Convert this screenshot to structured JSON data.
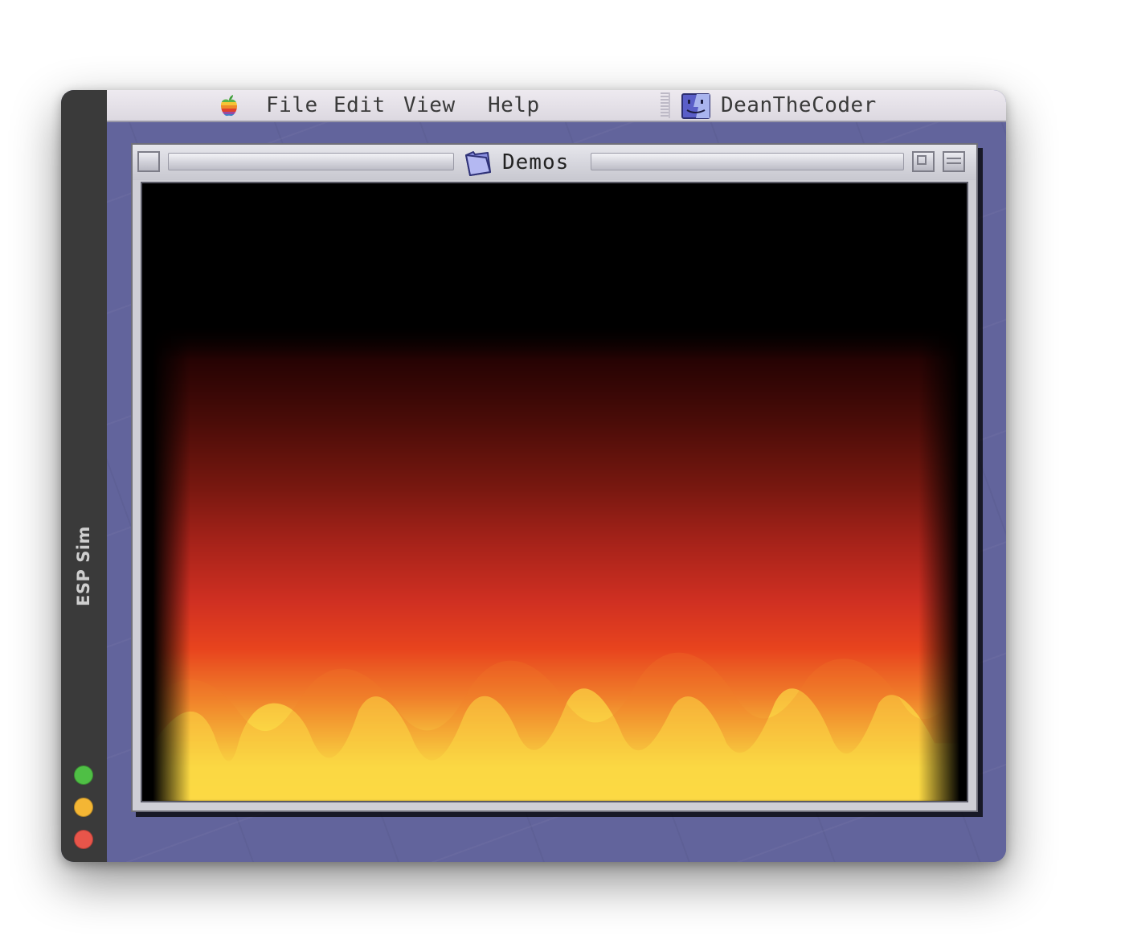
{
  "simulator": {
    "title": "ESP Sim",
    "indicator_colors": {
      "green": "#4fbf45",
      "yellow": "#f4b634",
      "red": "#e8554a"
    }
  },
  "menubar": {
    "apple_icon": "apple-rainbow-icon",
    "items": [
      "File",
      "Edit",
      "View",
      "Help"
    ],
    "app_icon": "mac-os-finder-icon",
    "app_name": "DeanTheCoder"
  },
  "window": {
    "folder_icon": "folder-icon",
    "title": "Demos",
    "content": "fire-animation"
  },
  "colors": {
    "desktop": "#62649c",
    "sidebar": "#3a3a3a",
    "flame_hot": "#fff24c",
    "flame_mid": "#e8441e",
    "flame_cool": "#781810"
  }
}
